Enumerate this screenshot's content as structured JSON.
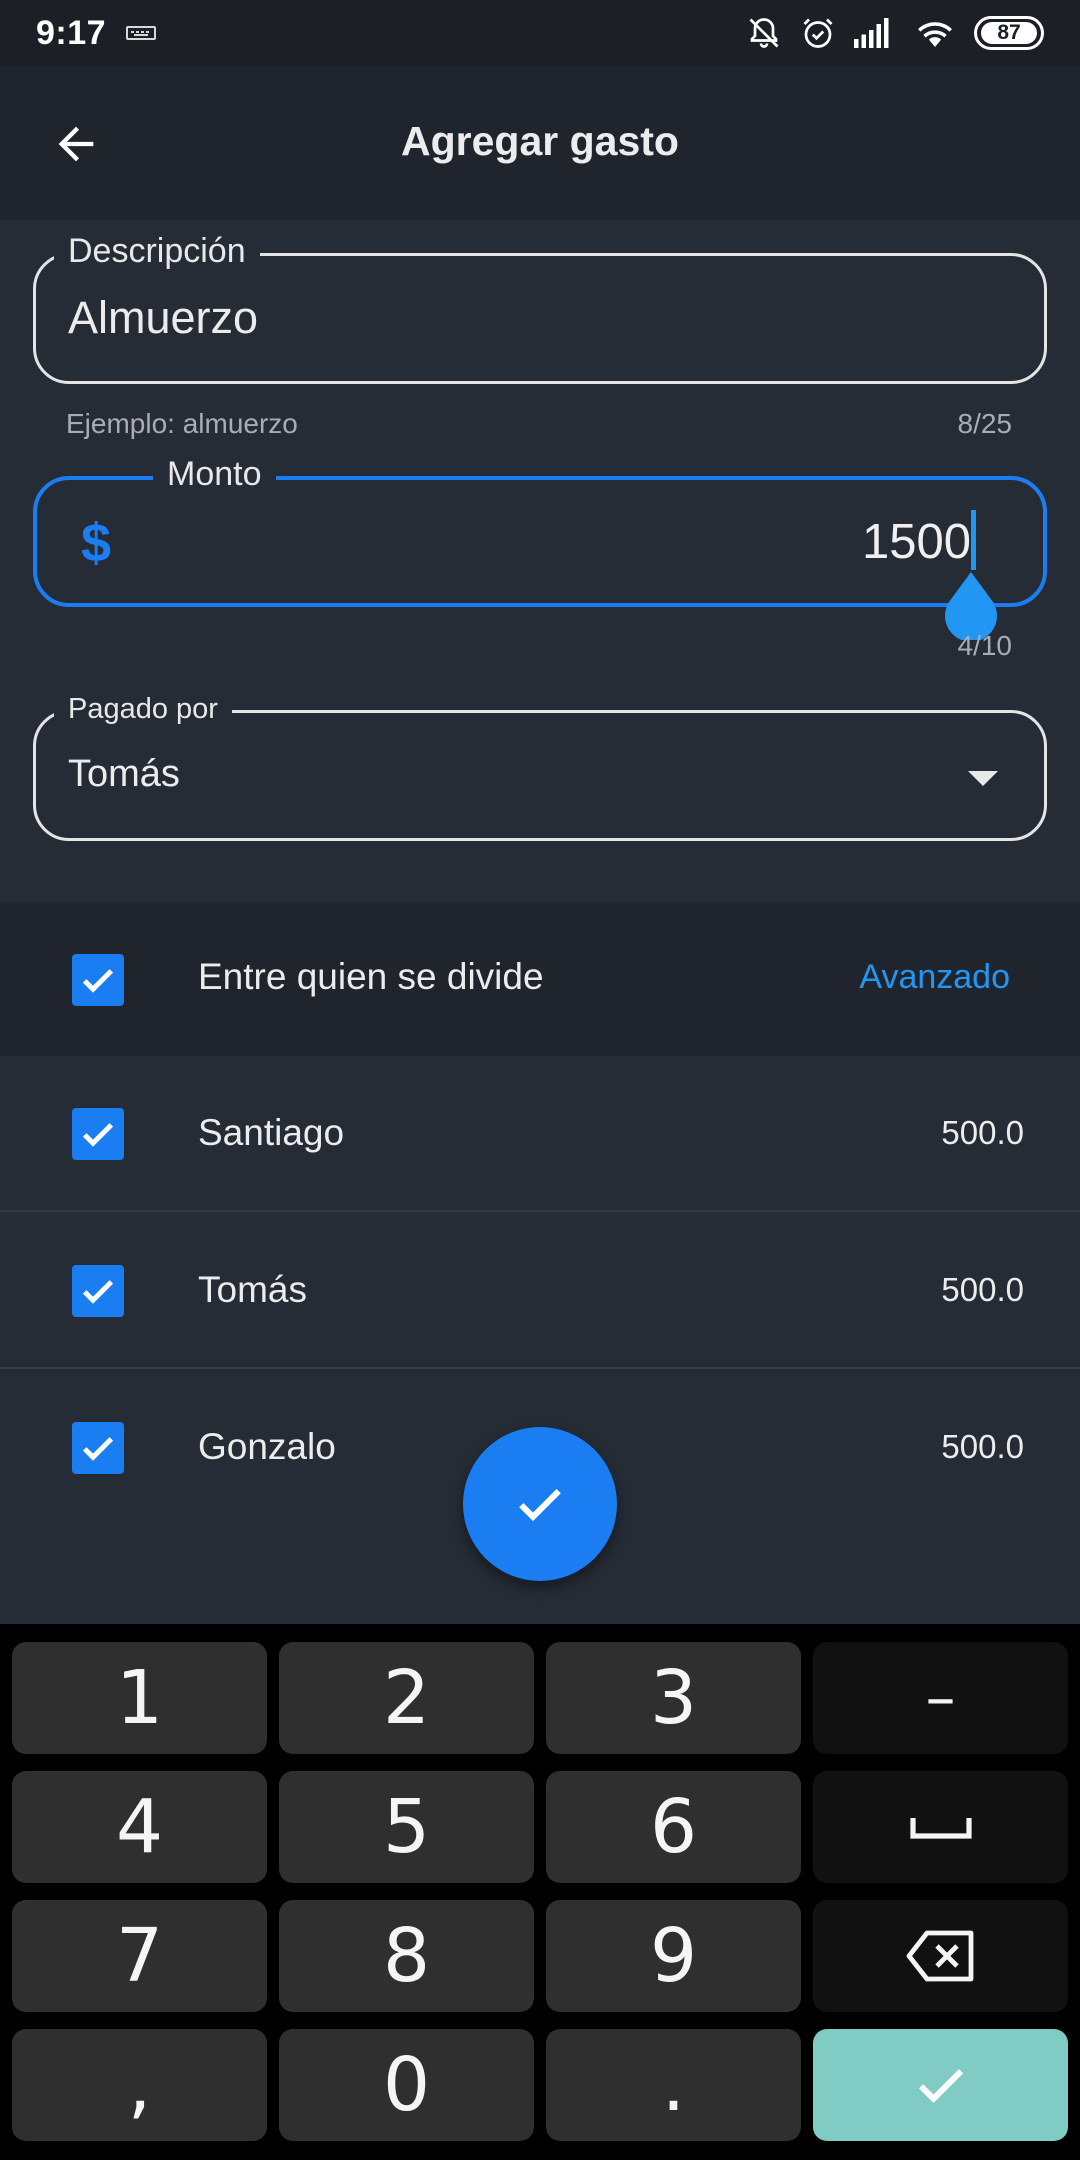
{
  "status_bar": {
    "time": "9:17",
    "battery": "87"
  },
  "app_bar": {
    "title": "Agregar gasto",
    "back_icon": "arrow-back-icon"
  },
  "description_field": {
    "label": "Descripción",
    "value": "Almuerzo",
    "helper": "Ejemplo: almuerzo",
    "counter": "8/25"
  },
  "amount_field": {
    "label": "Monto",
    "currency_symbol": "$",
    "value": "1500",
    "counter": "4/10",
    "accent_color": "#1a7ef2"
  },
  "paid_by_field": {
    "label": "Pagado por",
    "value": "Tomás"
  },
  "split": {
    "header_label": "Entre quien se divide",
    "header_checked": true,
    "advanced_label": "Avanzado",
    "members": [
      {
        "name": "Santiago",
        "amount": "500.0",
        "checked": true
      },
      {
        "name": "Tomás",
        "amount": "500.0",
        "checked": true
      },
      {
        "name": "Gonzalo",
        "amount": "500.0",
        "checked": true
      }
    ]
  },
  "fab": {
    "icon": "check-icon"
  },
  "keyboard": {
    "keys": {
      "k1": "1",
      "k2": "2",
      "k3": "3",
      "dash": "–",
      "k4": "4",
      "k5": "5",
      "k6": "6",
      "k7": "7",
      "k8": "8",
      "k9": "9",
      "comma": ",",
      "k0": "0",
      "dot": "."
    },
    "space_icon": "space-bar-icon",
    "backspace_icon": "backspace-icon",
    "done_icon": "check-icon",
    "done_color": "#80cbc4"
  }
}
